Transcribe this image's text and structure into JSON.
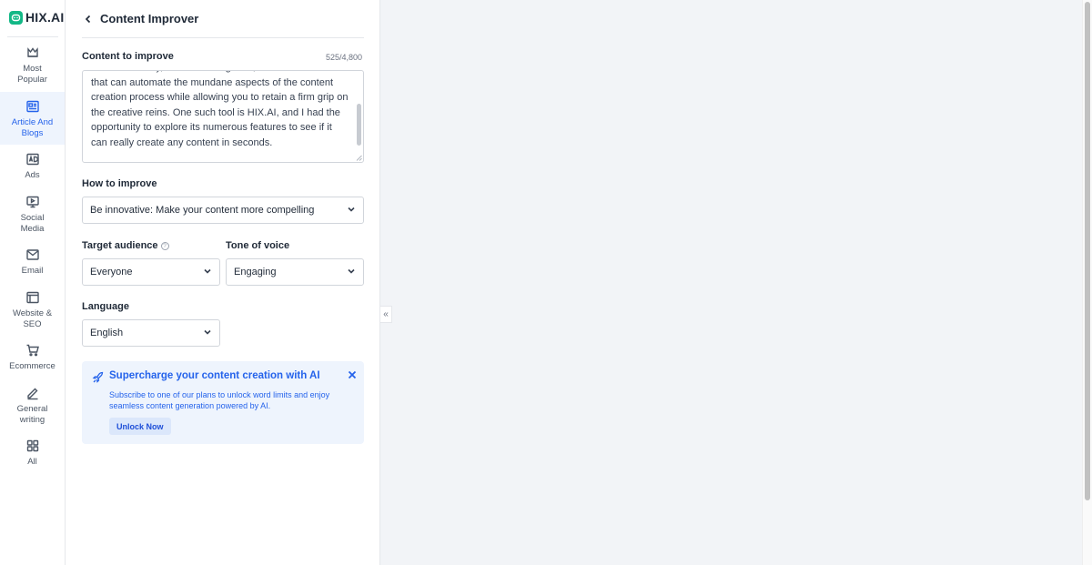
{
  "brand": {
    "name": "HIX.AI",
    "accent": "#12b886"
  },
  "nav": {
    "items": [
      {
        "label": "Most\nPopular",
        "icon": "crown-icon"
      },
      {
        "label": "Article And\nBlogs",
        "icon": "article-icon",
        "active": true
      },
      {
        "label": "Ads",
        "icon": "ad-icon"
      },
      {
        "label": "Social\nMedia",
        "icon": "monitor-icon"
      },
      {
        "label": "Email",
        "icon": "mail-icon"
      },
      {
        "label": "Website &\nSEO",
        "icon": "browser-icon"
      },
      {
        "label": "Ecommerce",
        "icon": "cart-icon"
      },
      {
        "label": "General\nwriting",
        "icon": "pen-icon"
      },
      {
        "label": "All",
        "icon": "grid-icon"
      }
    ]
  },
  "panel": {
    "title": "Content Improver",
    "content_label": "Content to improve",
    "counter": "525/4,800",
    "content_text": "creators exactly, artificial intelligence, and there are tools that can automate the mundane aspects of the content creation process while allowing you to retain a firm grip on the creative reins. One such tool is HIX.AI, and I had the opportunity to explore its numerous features to see if it can really create any content in seconds.",
    "how_label": "How to improve",
    "how_value": "Be innovative: Make your content more compelling",
    "audience_label": "Target audience",
    "audience_value": "Everyone",
    "tone_label": "Tone of voice",
    "tone_value": "Engaging",
    "language_label": "Language",
    "language_value": "English"
  },
  "promo": {
    "title": "Supercharge your content creation with AI",
    "description": "Subscribe to one of our plans to unlock word limits and enjoy seamless content generation powered by AI.",
    "button": "Unlock Now"
  },
  "collapse_glyph": "«",
  "colors": {
    "accent_blue": "#2563eb",
    "promo_bg": "#eef4fd"
  }
}
